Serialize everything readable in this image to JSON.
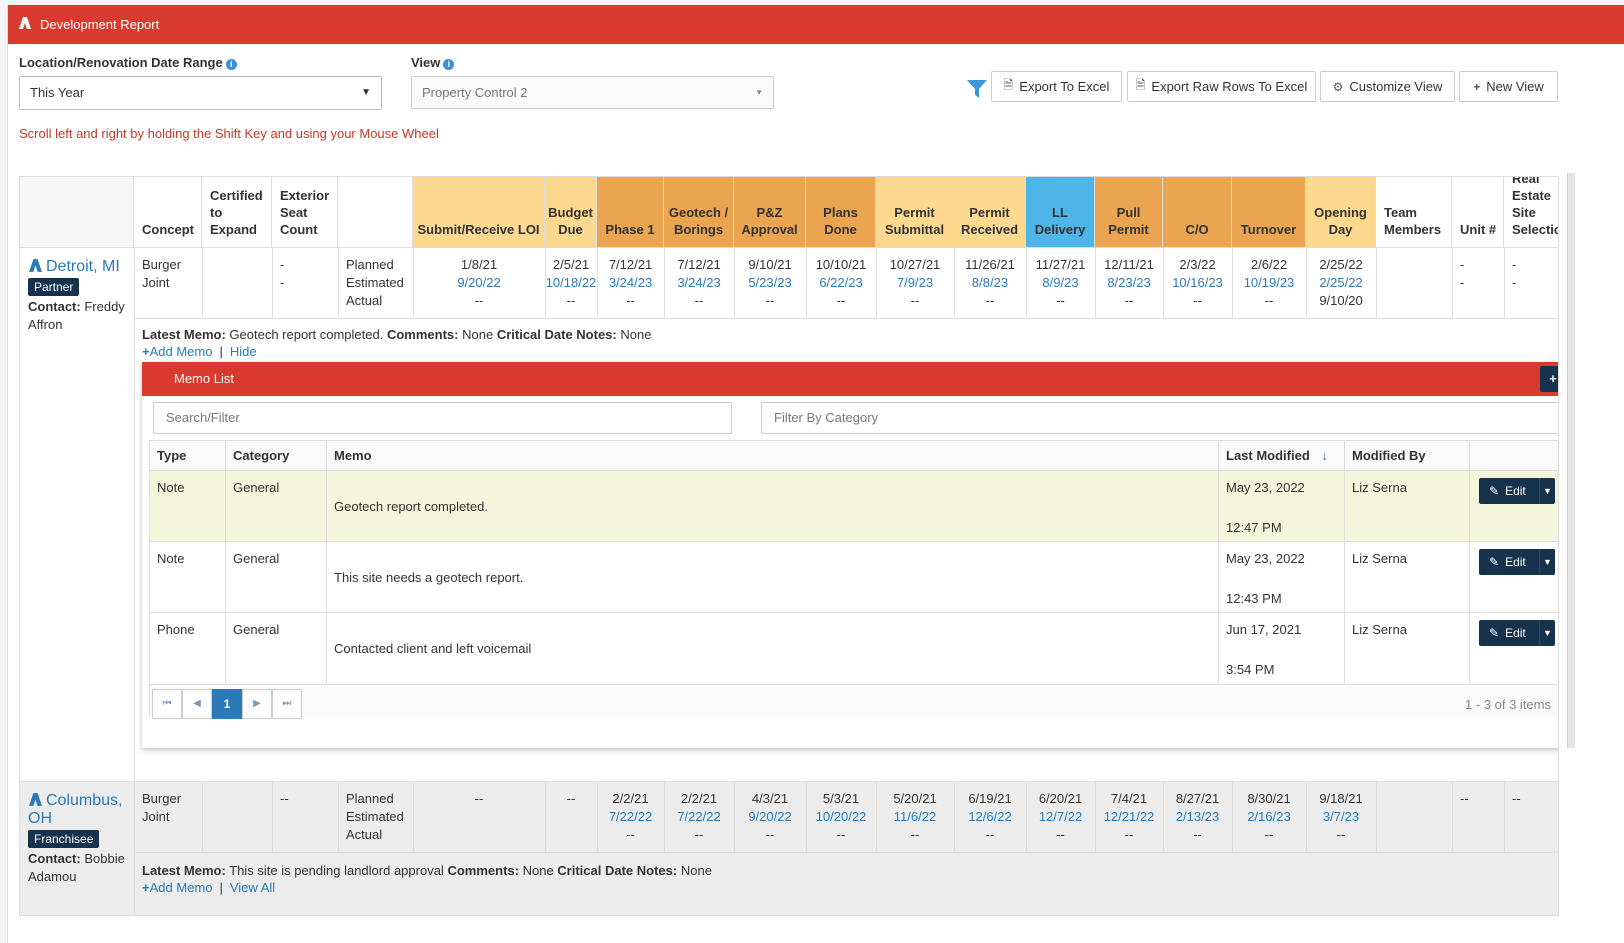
{
  "app": {
    "title": "Development Report"
  },
  "filters": {
    "date_range_label": "Location/Renovation Date Range",
    "date_range_value": "This Year",
    "view_label": "View",
    "view_value": "Property Control 2"
  },
  "toolbar": {
    "export_excel": "Export To Excel",
    "export_raw": "Export Raw Rows To Excel",
    "customize": "Customize View",
    "new_view": "New View"
  },
  "hint": "Scroll left and right by holding the Shift Key and using your Mouse Wheel",
  "columns": [
    {
      "label": "",
      "bg": "#f7f7f7"
    },
    {
      "label": "Concept",
      "bg": "#ffffff"
    },
    {
      "label": "Certified to Expand",
      "bg": "#ffffff"
    },
    {
      "label": "Exterior Seat Count",
      "bg": "#ffffff"
    },
    {
      "label": "",
      "bg": "#ffffff"
    },
    {
      "label": "Submit/Receive LOI",
      "bg": "#fdd98f"
    },
    {
      "label": "Budget Due",
      "bg": "#fdd98f"
    },
    {
      "label": "Phase 1",
      "bg": "#eba44f"
    },
    {
      "label": "Geotech / Borings",
      "bg": "#eba44f"
    },
    {
      "label": "P&Z Approval",
      "bg": "#eba44f"
    },
    {
      "label": "Plans Done",
      "bg": "#eba44f"
    },
    {
      "label": "Permit Submittal",
      "bg": "#fdd98f"
    },
    {
      "label": "Permit Received",
      "bg": "#fdd98f"
    },
    {
      "label": "LL Delivery",
      "bg": "#4db5e8"
    },
    {
      "label": "Pull Permit",
      "bg": "#eba44f"
    },
    {
      "label": "C/O",
      "bg": "#eba44f"
    },
    {
      "label": "Turnover",
      "bg": "#eba44f"
    },
    {
      "label": "Opening Day",
      "bg": "#fdd98f"
    },
    {
      "label": "Team Members",
      "bg": "#ffffff"
    },
    {
      "label": "Unit #",
      "bg": "#ffffff"
    },
    {
      "label": "Real Estate Site Selection",
      "bg": "#ffffff"
    }
  ],
  "rows": [
    {
      "location": "Detroit, MI",
      "badge": "Partner",
      "contact_label": "Contact:",
      "contact": "Freddy Affron",
      "concept": "Burger Joint",
      "certified": "",
      "seat_count": "--",
      "plan_labels": [
        "Planned",
        "Estimated",
        "Actual"
      ],
      "dates": [
        [
          "1/8/21",
          "9/20/22",
          "--"
        ],
        [
          "2/5/21",
          "10/18/22",
          "--"
        ],
        [
          "7/12/21",
          "3/24/23",
          "--"
        ],
        [
          "7/12/21",
          "3/24/23",
          "--"
        ],
        [
          "9/10/21",
          "5/23/23",
          "--"
        ],
        [
          "10/10/21",
          "6/22/23",
          "--"
        ],
        [
          "10/27/21",
          "7/9/23",
          "--"
        ],
        [
          "11/26/21",
          "8/8/23",
          "--"
        ],
        [
          "11/27/21",
          "8/9/23",
          "--"
        ],
        [
          "12/11/21",
          "8/23/23",
          "--"
        ],
        [
          "2/3/22",
          "10/16/23",
          "--"
        ],
        [
          "2/6/22",
          "10/19/23",
          "--"
        ],
        [
          "2/25/22",
          "2/25/22",
          "9/10/20"
        ]
      ],
      "team": "",
      "unit": "--",
      "site": "--",
      "latest_memo_label": "Latest Memo:",
      "latest_memo": "Geotech report completed.",
      "comments_label": "Comments:",
      "comments": "None",
      "notes_label": "Critical Date Notes:",
      "notes": "None",
      "add_memo": "Add Memo",
      "toggle": "Hide"
    },
    {
      "location": "Columbus, OH",
      "badge": "Franchisee",
      "contact_label": "Contact:",
      "contact": "Bobbie Adamou",
      "concept": "Burger Joint",
      "certified": "",
      "seat_count": "--",
      "plan_labels": [
        "Planned",
        "Estimated",
        "Actual"
      ],
      "dates": [
        [
          "--",
          "",
          ""
        ],
        [
          "--",
          "",
          ""
        ],
        [
          "2/2/21",
          "7/22/22",
          "--"
        ],
        [
          "2/2/21",
          "7/22/22",
          "--"
        ],
        [
          "4/3/21",
          "9/20/22",
          "--"
        ],
        [
          "5/3/21",
          "10/20/22",
          "--"
        ],
        [
          "5/20/21",
          "11/6/22",
          "--"
        ],
        [
          "6/19/21",
          "12/6/22",
          "--"
        ],
        [
          "6/20/21",
          "12/7/22",
          "--"
        ],
        [
          "7/4/21",
          "12/21/22",
          "--"
        ],
        [
          "8/27/21",
          "2/13/23",
          "--"
        ],
        [
          "8/30/21",
          "2/16/23",
          "--"
        ],
        [
          "9/18/21",
          "3/7/23",
          "--"
        ]
      ],
      "team": "",
      "unit": "--",
      "site": "--",
      "latest_memo_label": "Latest Memo:",
      "latest_memo": "This site is pending landlord approval",
      "comments_label": "Comments:",
      "comments": "None",
      "notes_label": "Critical Date Notes:",
      "notes": "None",
      "add_memo": "Add Memo",
      "toggle": "View All"
    }
  ],
  "memo_list": {
    "title": "Memo List",
    "search_placeholder": "Search/Filter",
    "category_placeholder": "Filter By Category",
    "headers": [
      "Type",
      "Category",
      "Memo",
      "Last Modified",
      "Modified By",
      ""
    ],
    "rows": [
      {
        "type": "Note",
        "category": "General",
        "memo": "Geotech report completed.",
        "date": "May 23, 2022",
        "time": "12:47 PM",
        "by": "Liz Serna",
        "action": "Edit"
      },
      {
        "type": "Note",
        "category": "General",
        "memo": "This site needs a geotech report.",
        "date": "May 23, 2022",
        "time": "12:43 PM",
        "by": "Liz Serna",
        "action": "Edit"
      },
      {
        "type": "Phone",
        "category": "General",
        "memo": "Contacted client and left voicemail",
        "date": "Jun 17, 2021",
        "time": "3:54 PM",
        "by": "Liz Serna",
        "action": "Edit"
      }
    ],
    "current_page": "1",
    "items_info": "1 - 3 of 3 items"
  },
  "colors": {
    "brand_red": "#d83a30",
    "navy": "#17324d",
    "link_blue": "#2a7ab8"
  }
}
